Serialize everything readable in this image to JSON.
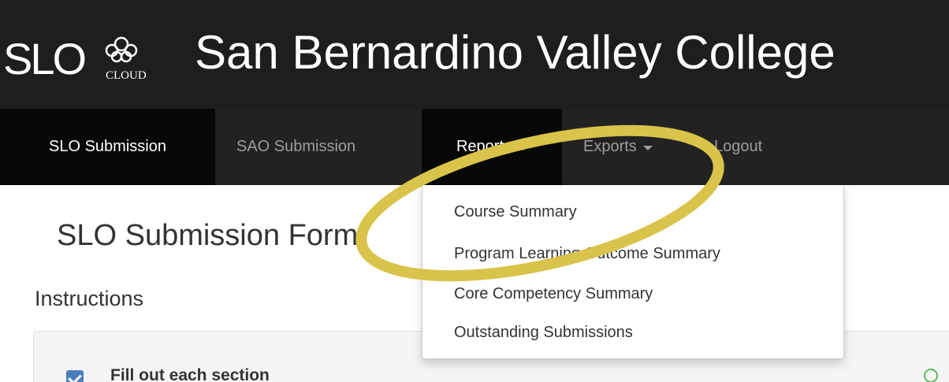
{
  "header": {
    "logo_text": "SLO",
    "logo_subtext": "CLOUD",
    "college_name": "San Bernardino Valley College"
  },
  "nav": {
    "items": [
      {
        "label": "SLO Submission"
      },
      {
        "label": "SAO Submission"
      },
      {
        "label": "Reports"
      },
      {
        "label": "Exports"
      },
      {
        "label": "Logout"
      }
    ]
  },
  "reports_menu": {
    "items": [
      {
        "label": "Course Summary"
      },
      {
        "label": "Program Learning Outcome Summary"
      },
      {
        "label": "Core Competency Summary"
      },
      {
        "label": "Outstanding Submissions"
      }
    ]
  },
  "main": {
    "title": "SLO Submission Form",
    "instructions_heading": "Instructions",
    "checklist": [
      {
        "label": "Fill out each section",
        "checked": true
      }
    ]
  },
  "colors": {
    "header_bg": "#1e1e1e",
    "navbar_bg": "#222222",
    "active_nav_bg": "#080808",
    "highlight_ring": "#d9c34a",
    "checkbox": "#4a7fbf"
  }
}
